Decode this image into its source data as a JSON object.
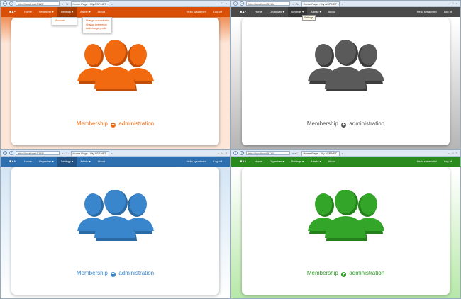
{
  "browser": {
    "address": "http://localhost:5115/",
    "address_icons": "⌕ ▾ ↻",
    "tab_title": "Home Page - My ASP.NET ...",
    "tab_close": "×",
    "window_controls": "– □ ×"
  },
  "navbar": {
    "brand": "■▲•",
    "items": [
      "Home",
      "Organizer ▾",
      "Settings ▾",
      "Admin ▾",
      "About"
    ],
    "right": [
      "Hello sysadmin!",
      "Log off"
    ]
  },
  "menus": {
    "organizer_dropdown": [
      "Account"
    ],
    "settings_dropdown": [
      "Change account info",
      "Change preference",
      "Add/change profile"
    ],
    "settings_tooltip": "Settings"
  },
  "main": {
    "membership_word1": "Membership",
    "plus_icon_glyph": "+",
    "membership_word2": "administration"
  },
  "themes": [
    {
      "name": "orange",
      "navbar": "#d94f06",
      "accent": "#f26a10",
      "dark": "#c14d06",
      "page_bg": "#fde6d8"
    },
    {
      "name": "gray",
      "navbar": "#4a4a4a",
      "accent": "#5a5a5a",
      "dark": "#3d3d3d",
      "page_bg": "#b5b5b5"
    },
    {
      "name": "blue",
      "navbar": "#2e6fb0",
      "accent": "#3a86cc",
      "dark": "#2a6aa5",
      "page_bg": "#cfe2f3"
    },
    {
      "name": "green",
      "navbar": "#2a8a1e",
      "accent": "#33a62a",
      "dark": "#23801a",
      "page_bg": "#b7e8a8"
    }
  ]
}
